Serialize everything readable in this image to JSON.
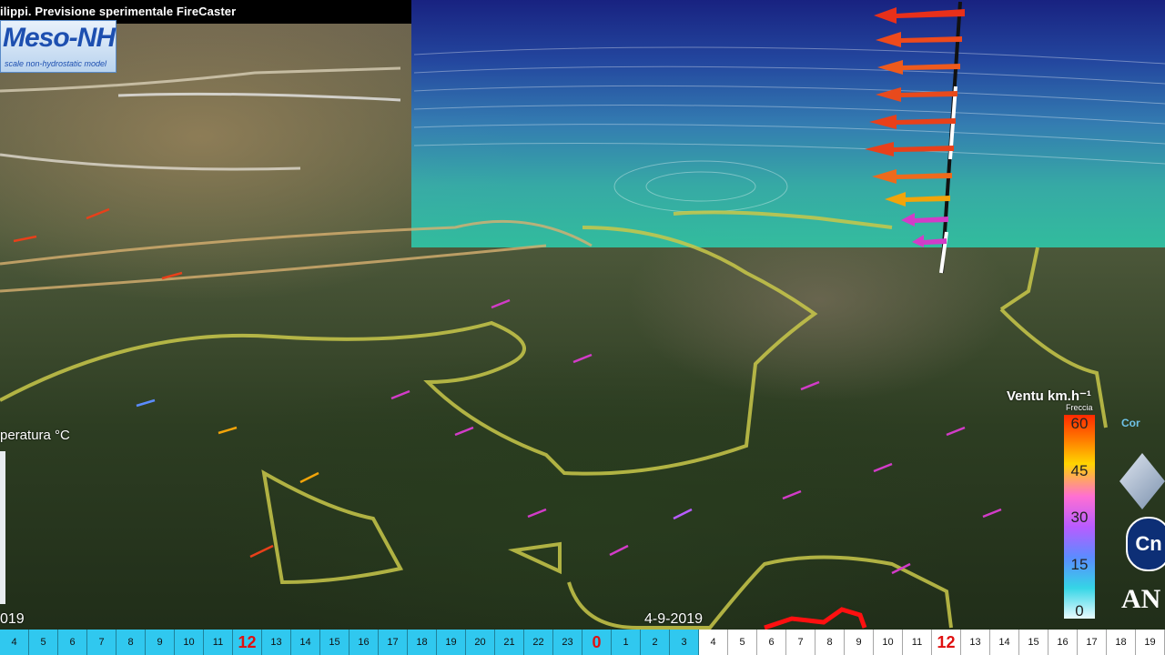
{
  "title": "ilippi. Previsione sperimentale FireCaster",
  "logo": {
    "name": "Meso-NH",
    "subtitle": "scale non-hydrostatic model"
  },
  "temperature_label": "peratura °C",
  "year_left": "019",
  "date": "4-9-2019",
  "wind_legend": {
    "title": "Ventu km.h⁻¹",
    "subtitle": "Freccia",
    "ticks": [
      "60",
      "45",
      "30",
      "15",
      "0"
    ]
  },
  "right_logos": {
    "circle_text": "Cn",
    "bottom_text": "AN",
    "cam_text": "Cor"
  },
  "timeline": [
    {
      "label": "4",
      "state": "past"
    },
    {
      "label": "5",
      "state": "past"
    },
    {
      "label": "6",
      "state": "past"
    },
    {
      "label": "7",
      "state": "past"
    },
    {
      "label": "8",
      "state": "past"
    },
    {
      "label": "9",
      "state": "past"
    },
    {
      "label": "10",
      "state": "past"
    },
    {
      "label": "11",
      "state": "past"
    },
    {
      "label": "12",
      "state": "past",
      "highlight": true
    },
    {
      "label": "13",
      "state": "past"
    },
    {
      "label": "14",
      "state": "past"
    },
    {
      "label": "15",
      "state": "past"
    },
    {
      "label": "16",
      "state": "past"
    },
    {
      "label": "17",
      "state": "past"
    },
    {
      "label": "18",
      "state": "past"
    },
    {
      "label": "19",
      "state": "past"
    },
    {
      "label": "20",
      "state": "past"
    },
    {
      "label": "21",
      "state": "past"
    },
    {
      "label": "22",
      "state": "past"
    },
    {
      "label": "23",
      "state": "past"
    },
    {
      "label": "0",
      "state": "past",
      "highlight": true
    },
    {
      "label": "1",
      "state": "past"
    },
    {
      "label": "2",
      "state": "past"
    },
    {
      "label": "3",
      "state": "past"
    },
    {
      "label": "4",
      "state": "future"
    },
    {
      "label": "5",
      "state": "future"
    },
    {
      "label": "6",
      "state": "future"
    },
    {
      "label": "7",
      "state": "future"
    },
    {
      "label": "8",
      "state": "future"
    },
    {
      "label": "9",
      "state": "future"
    },
    {
      "label": "10",
      "state": "future"
    },
    {
      "label": "11",
      "state": "future"
    },
    {
      "label": "12",
      "state": "future",
      "highlight": true
    },
    {
      "label": "13",
      "state": "future"
    },
    {
      "label": "14",
      "state": "future"
    },
    {
      "label": "15",
      "state": "future"
    },
    {
      "label": "16",
      "state": "future"
    },
    {
      "label": "17",
      "state": "future"
    },
    {
      "label": "18",
      "state": "future"
    },
    {
      "label": "19",
      "state": "future"
    }
  ],
  "colors": {
    "timeline_past": "#30c8ef",
    "timeline_future": "#ffffff",
    "timeline_highlight": "#e01010",
    "contour_yellow": "#c9c84a",
    "arrow_red": "#e8401a",
    "arrow_magenta": "#d23cc8"
  }
}
